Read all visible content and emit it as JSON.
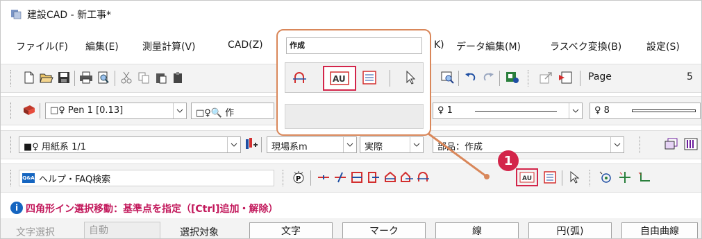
{
  "window": {
    "title": "建設CAD - 新工事*"
  },
  "menu": [
    {
      "label": "ファイル(F)"
    },
    {
      "label": "編集(E)"
    },
    {
      "label": "測量計算(V)"
    },
    {
      "label": "CAD(Z)"
    },
    {
      "label": "K)"
    },
    {
      "label": "データ編集(M)"
    },
    {
      "label": "ラスベク変換(B)"
    },
    {
      "label": "設定(S)"
    }
  ],
  "toolbar1": {
    "page_label": "Page",
    "page_value": "5"
  },
  "toolbar2": {
    "pen_combo": "□♀ Pen 1 [0.13]",
    "layer_combo": "□♀🔍 作",
    "line_label": "♀ 1",
    "size_label": "♀ 8"
  },
  "toolbar3": {
    "paper_combo": "■♀ 用紙系 1/1",
    "coord_combo": "現場系m",
    "scale_combo": "実際",
    "parts_combo": "部品：作成"
  },
  "toolbar4": {
    "help_search": "ヘルプ・FAQ検索",
    "help_badge": "Q&A"
  },
  "zoom_panel": {
    "title": "作成"
  },
  "callout": {
    "number": "1"
  },
  "status": {
    "message": "四角形イン選択移動：基準点を指定（[Ctrl]追加・解除）"
  },
  "selection_bar": {
    "label_text_select": "文字選択",
    "auto_value": "自動",
    "label_target": "選択対象",
    "buttons": [
      "文字",
      "マーク",
      "線",
      "円(弧)",
      "自由曲線"
    ]
  },
  "colors": {
    "accent_red": "#d3254a",
    "zoom_border": "#d9875a",
    "callout_line": "#d9875a"
  }
}
